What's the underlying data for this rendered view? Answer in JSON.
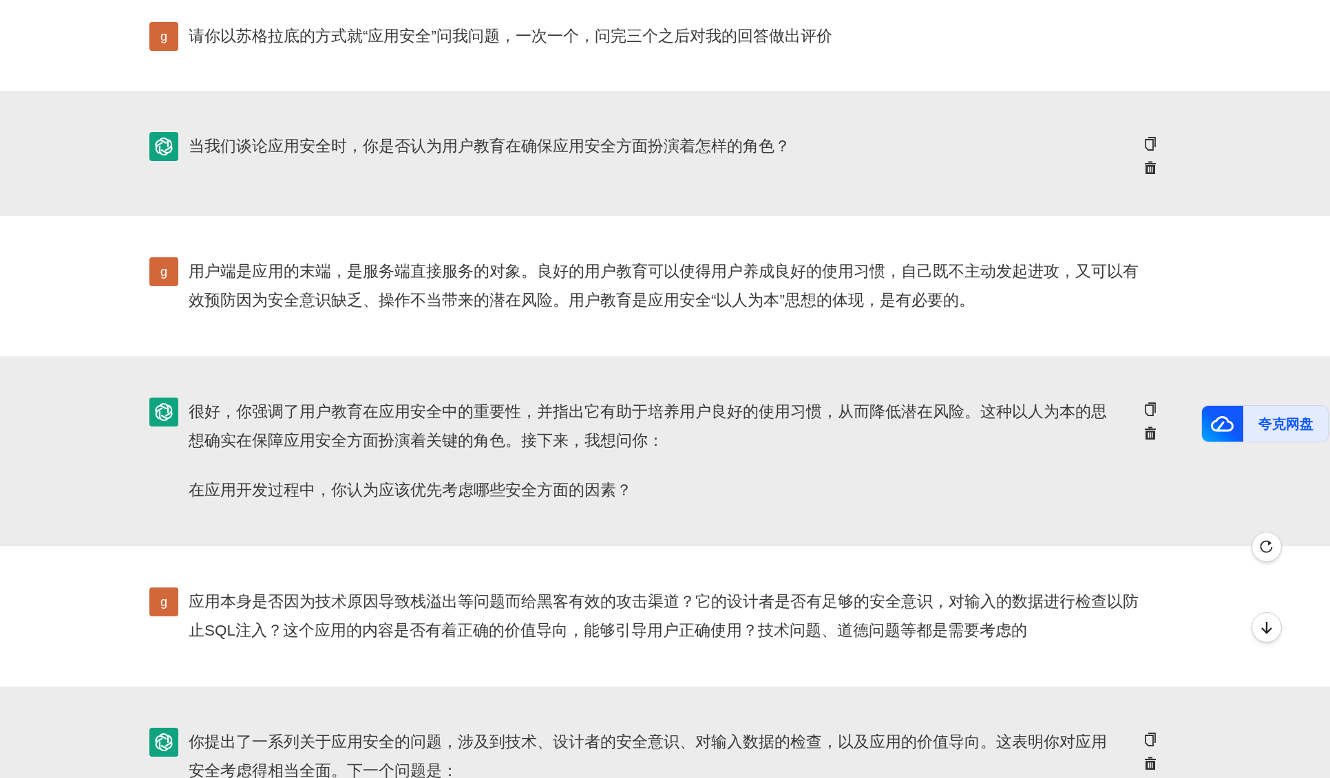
{
  "messages": [
    {
      "kind": "user",
      "avatar": "g",
      "paragraphs": [
        "请你以苏格拉底的方式就“应用安全”问我问题，一次一个，问完三个之后对我的回答做出评价"
      ]
    },
    {
      "kind": "assistant",
      "paragraphs": [
        "当我们谈论应用安全时，你是否认为用户教育在确保应用安全方面扮演着怎样的角色？"
      ]
    },
    {
      "kind": "user",
      "avatar": "g",
      "paragraphs": [
        "用户端是应用的末端，是服务端直接服务的对象。良好的用户教育可以使得用户养成良好的使用习惯，自己既不主动发起进攻，又可以有效预防因为安全意识缺乏、操作不当带来的潜在风险。用户教育是应用安全“以人为本”思想的体现，是有必要的。"
      ]
    },
    {
      "kind": "assistant",
      "paragraphs": [
        "很好，你强调了用户教育在应用安全中的重要性，并指出它有助于培养用户良好的使用习惯，从而降低潜在风险。这种以人为本的思想确实在保障应用安全方面扮演着关键的角色。接下来，我想问你：",
        "在应用开发过程中，你认为应该优先考虑哪些安全方面的因素？"
      ]
    },
    {
      "kind": "user",
      "avatar": "g",
      "paragraphs": [
        "应用本身是否因为技术原因导致栈溢出等问题而给黑客有效的攻击渠道？它的设计者是否有足够的安全意识，对输入的数据进行检查以防止SQL注入？这个应用的内容是否有着正确的价值导向，能够引导用户正确使用？技术问题、道德问题等都是需要考虑的"
      ]
    },
    {
      "kind": "assistant",
      "paragraphs": [
        "你提出了一系列关于应用安全的问题，涉及到技术、设计者的安全意识、对输入数据的检查，以及应用的价值导向。这表明你对应用安全考虑得相当全面。下一个问题是："
      ]
    }
  ],
  "quark_button": {
    "label": "夸克网盘"
  }
}
